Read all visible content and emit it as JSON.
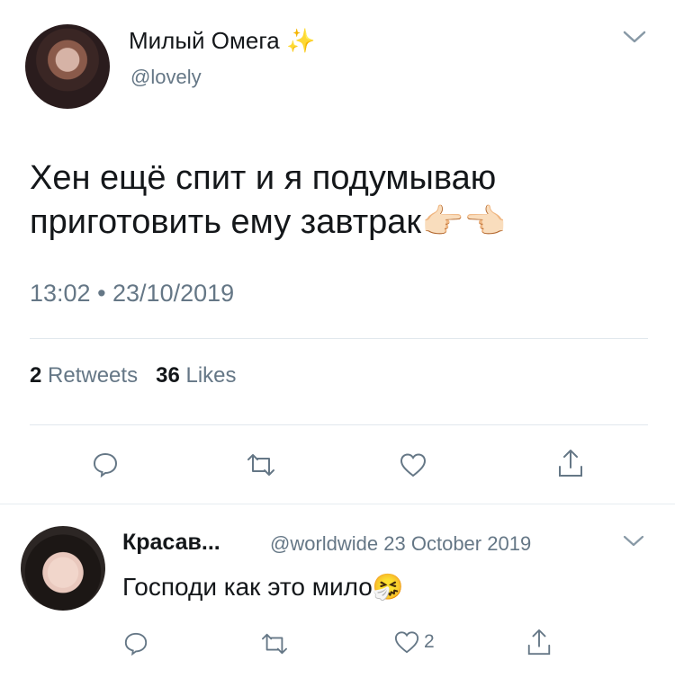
{
  "tweet": {
    "author_name": "Милый Омега",
    "author_emoji": "✨",
    "author_handle": "@lovely",
    "text": "Хен ещё спит и я подумываю приготовить ему завтрак",
    "text_emoji": "👉🏻👈🏻",
    "timestamp": "13:02 • 23/10/2019",
    "retweets_count": "2",
    "retweets_label": "Retweets",
    "likes_count": "36",
    "likes_label": "Likes"
  },
  "reply": {
    "author_name": "Красав...",
    "author_handle": "@worldwide",
    "date": "23 October 2019",
    "text": "Господи как это мило",
    "text_emoji": "🤧",
    "likes_count": "2"
  },
  "icons": {
    "reply": "comment-icon",
    "retweet": "retweet-icon",
    "like": "heart-icon",
    "share": "share-icon",
    "menu": "chevron-down-icon"
  },
  "colors": {
    "text": "#14171a",
    "secondary": "#657786",
    "divider": "#e1e8ed"
  }
}
